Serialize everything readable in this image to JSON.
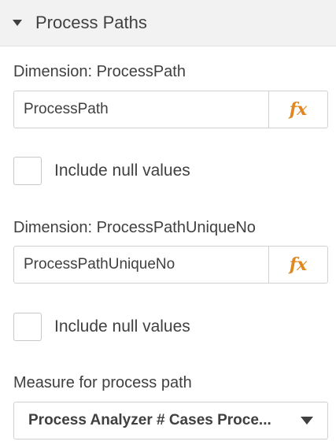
{
  "section": {
    "title": "Process Paths",
    "caret_icon": "caret-down-icon"
  },
  "dimension1": {
    "label": "Dimension: ProcessPath",
    "value": "ProcessPath",
    "fx_label": "fx",
    "null_label": "Include null values",
    "include_null": false
  },
  "dimension2": {
    "label": "Dimension: ProcessPathUniqueNo",
    "value": "ProcessPathUniqueNo",
    "fx_label": "fx",
    "null_label": "Include null values",
    "include_null": false
  },
  "measure": {
    "label": "Measure for process path",
    "selected": "Process Analyzer # Cases Proce..."
  },
  "colors": {
    "fx_accent": "#e0871f",
    "header_bg": "#f2f2f2",
    "text": "#404040"
  }
}
